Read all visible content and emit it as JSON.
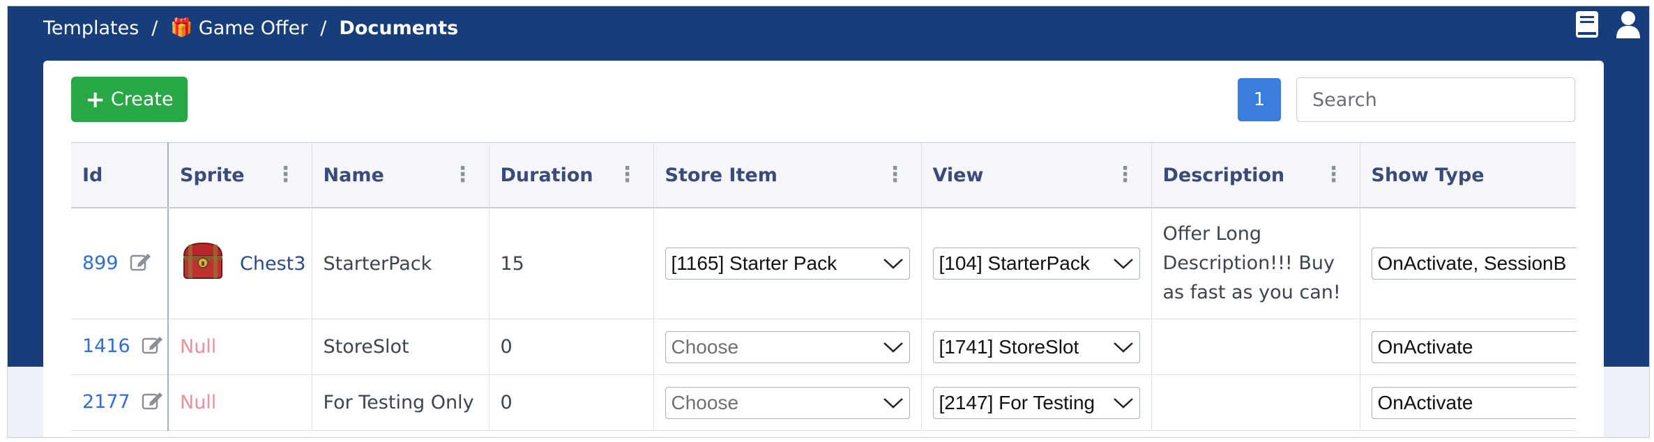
{
  "breadcrumb": {
    "items": [
      "Templates",
      "Game Offer",
      "Documents"
    ],
    "gift_glyph": "🎁"
  },
  "toolbar": {
    "create_label": "Create",
    "page_number": "1",
    "search_placeholder": "Search"
  },
  "icons": {
    "top": [
      "book-icon",
      "user-icon"
    ],
    "row": [
      "edit-icon",
      "chevron-down-icon",
      "kebab-icon"
    ]
  },
  "colors": {
    "header_bg": "#173d7a",
    "create_btn": "#28a745",
    "page_btn": "#3b7ddd",
    "link": "#2f6fd4",
    "null": "#ef8f9e"
  },
  "table": {
    "columns": [
      "Id",
      "Sprite",
      "Name",
      "Duration",
      "Store Item",
      "View",
      "Description",
      "Show Type"
    ],
    "rows": [
      {
        "id": "899",
        "sprite": "Chest3",
        "name": "StarterPack",
        "duration": "15",
        "store_item": "[1165] Starter Pack",
        "view": "[104] StarterPack",
        "description": "Offer Long Description!!! Buy as fast as you can!",
        "show_type": "OnActivate, SessionB"
      },
      {
        "id": "1416",
        "sprite": "Null",
        "name": "StoreSlot",
        "duration": "0",
        "store_item": "Choose",
        "view": "[1741] StoreSlot",
        "description": "",
        "show_type": "OnActivate"
      },
      {
        "id": "2177",
        "sprite": "Null",
        "name": "For Testing Only",
        "duration": "0",
        "store_item": "Choose",
        "view": "[2147] For Testing",
        "description": "",
        "show_type": "OnActivate"
      }
    ]
  }
}
